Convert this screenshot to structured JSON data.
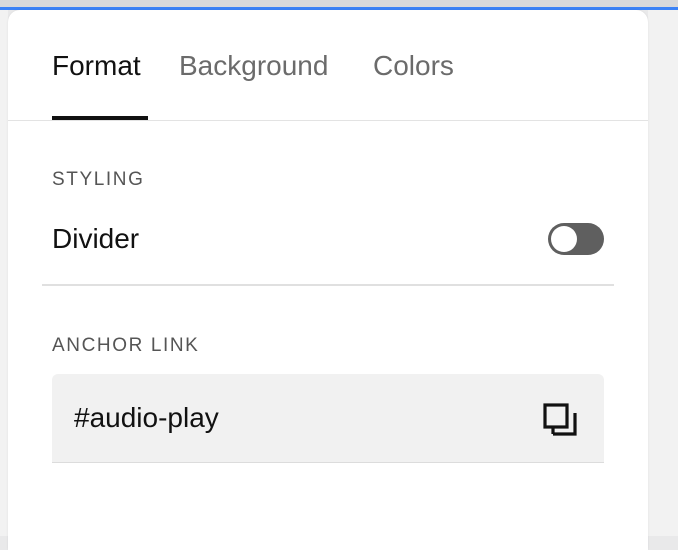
{
  "tabs": [
    {
      "label": "Format",
      "active": true
    },
    {
      "label": "Background",
      "active": false
    },
    {
      "label": "Colors",
      "active": false
    }
  ],
  "styling": {
    "section_label": "STYLING",
    "divider_label": "Divider",
    "divider_enabled": false
  },
  "anchor": {
    "section_label": "ANCHOR LINK",
    "value": "#audio-play",
    "copy_icon": "copy-icon"
  },
  "colors": {
    "accent": "#3b82f6",
    "toggle_off": "#5f5f5f",
    "text_primary": "#111111",
    "text_muted": "#6b6b6b"
  }
}
